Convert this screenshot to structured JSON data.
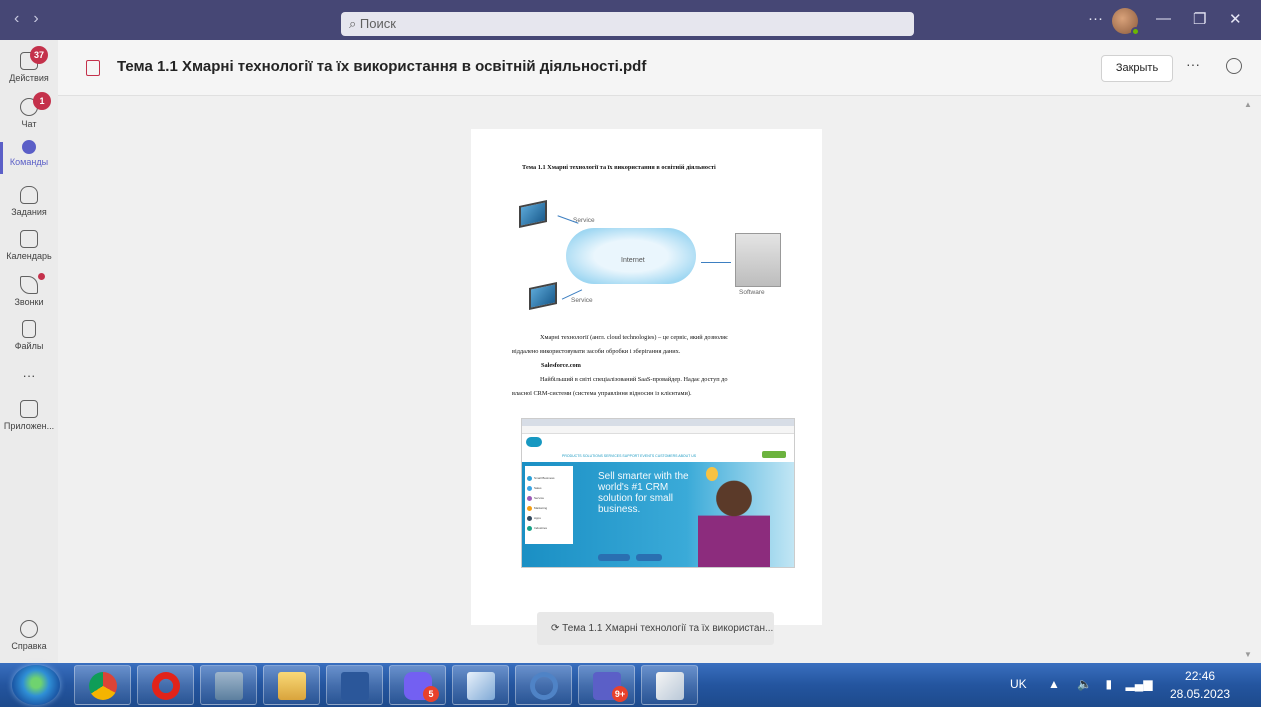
{
  "titlebar": {
    "back": "‹",
    "forward": "›",
    "search_placeholder": "Поиск",
    "more": "···",
    "minimize": "—",
    "maximize": "❐",
    "close": "✕"
  },
  "rail": {
    "items": [
      {
        "label": "Действия",
        "badge": "37"
      },
      {
        "label": "Чат",
        "badge": "1"
      },
      {
        "label": "Команды"
      },
      {
        "label": "Задания"
      },
      {
        "label": "Календарь"
      },
      {
        "label": "Звонки"
      },
      {
        "label": "Файлы"
      },
      {
        "label": "···"
      },
      {
        "label": "Приложен..."
      },
      {
        "label": "Справка"
      }
    ]
  },
  "header": {
    "title": "Тема 1.1 Хмарні технології та їх використання в освітній діяльності.pdf",
    "close_label": "Закрыть",
    "more": "···"
  },
  "document": {
    "heading": "Тема 1.1 Хмарні технології та їх використання в освітній діяльності",
    "diagram": {
      "service_top": "Service",
      "service_bottom": "Service",
      "internet": "Internet",
      "software": "Software"
    },
    "para1_line1": "Хмарні технології (англ. cloud technologies) – це сервіс, який дозволяє",
    "para1_line2": "віддалено використовувати засоби обробки і зберігання даних.",
    "subheading": "Salesforce.com",
    "para2_line1": "Найбільший в світі спеціалізований SaaS-провайдер. Надає доступ до",
    "para2_line2": "власної CRM-системи (система управління відносин із клієнтами).",
    "screenshot_headline": "Sell smarter with the world's #1 CRM solution for small business.",
    "screenshot_menu": "PRODUCTS  SOLUTIONS  SERVICES  SUPPORT  EVENTS  CUSTOMERS  ABOUT US",
    "screenshot_side": [
      "Small Business",
      "Sales",
      "Service",
      "Marketing",
      "Apps",
      "Industries"
    ]
  },
  "filename_pill": "Тема 1.1 Хмарні технології та їх використан...",
  "taskbar": {
    "viber_badge": "5",
    "teams_badge": "9+",
    "lang": "UK",
    "time": "22:46",
    "date": "28.05.2023"
  },
  "colors": {
    "titlebar": "#464775",
    "accent": "#5b5fc7",
    "badge": "#c4314b"
  }
}
